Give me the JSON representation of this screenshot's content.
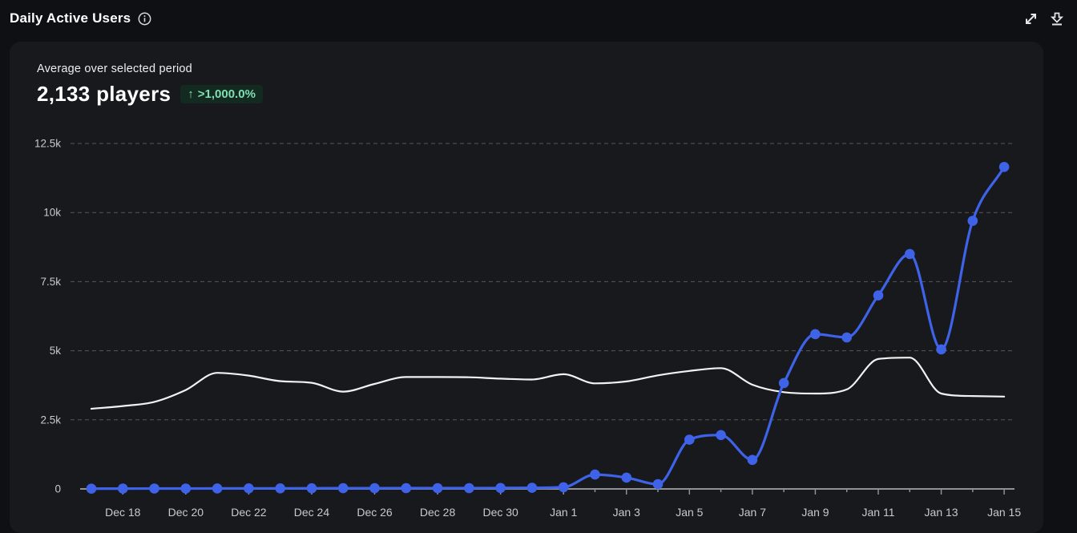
{
  "header": {
    "title": "Daily Active Users",
    "icons": [
      "info-icon",
      "expand-icon",
      "download-icon"
    ]
  },
  "summary": {
    "label": "Average over selected period",
    "value": "2,133 players",
    "trend_arrow": "↑",
    "trend_text": ">1,000.0%"
  },
  "chart_data": {
    "type": "line",
    "x": [
      "Dec 17",
      "Dec 18",
      "Dec 19",
      "Dec 20",
      "Dec 21",
      "Dec 22",
      "Dec 23",
      "Dec 24",
      "Dec 25",
      "Dec 26",
      "Dec 27",
      "Dec 28",
      "Dec 29",
      "Dec 30",
      "Dec 31",
      "Jan 1",
      "Jan 2",
      "Jan 3",
      "Jan 4",
      "Jan 5",
      "Jan 6",
      "Jan 7",
      "Jan 8",
      "Jan 9",
      "Jan 10",
      "Jan 11",
      "Jan 12",
      "Jan 13",
      "Jan 14",
      "Jan 15"
    ],
    "x_tick_labels": [
      "Dec 18",
      "Dec 20",
      "Dec 22",
      "Dec 24",
      "Dec 26",
      "Dec 28",
      "Dec 30",
      "Jan 1",
      "Jan 3",
      "Jan 5",
      "Jan 7",
      "Jan 9",
      "Jan 11",
      "Jan 13",
      "Jan 15"
    ],
    "series": [
      {
        "name": "white-line",
        "color": "#f2f2f2",
        "stroke_width": 2.2,
        "points": false,
        "values": [
          2900,
          3000,
          3150,
          3580,
          4200,
          4100,
          3900,
          3840,
          3520,
          3800,
          4050,
          4050,
          4040,
          3990,
          3960,
          4150,
          3820,
          3890,
          4110,
          4270,
          4370,
          3770,
          3500,
          3450,
          3600,
          4700,
          4750,
          3450,
          3360,
          3340
        ]
      },
      {
        "name": "blue-line",
        "color": "#3f63e8",
        "stroke_width": 3.2,
        "points": true,
        "values": [
          10,
          12,
          15,
          15,
          18,
          20,
          20,
          22,
          25,
          25,
          28,
          30,
          30,
          35,
          40,
          60,
          520,
          410,
          170,
          1780,
          1950,
          1050,
          3830,
          5600,
          5480,
          7000,
          8500,
          5050,
          9700,
          11650
        ]
      }
    ],
    "ylim": [
      0,
      12500
    ],
    "yticks": [
      0,
      2500,
      5000,
      7500,
      10000,
      12500
    ],
    "ytick_labels": [
      "0",
      "2.5k",
      "5k",
      "7.5k",
      "10k",
      "12.5k"
    ],
    "grid": "horizontal-dashed",
    "legend": "none",
    "title": "Daily Active Users"
  },
  "colors": {
    "page_bg": "#0f1014",
    "card_bg": "#18191d",
    "accent_blue": "#3f63e8",
    "comparison_white": "#f2f2f2",
    "badge_bg": "#132a20",
    "badge_text": "#7fe0b2",
    "gridline": "#56575b",
    "axis": "#8f9195",
    "axis_label": "#c7c9cc"
  }
}
